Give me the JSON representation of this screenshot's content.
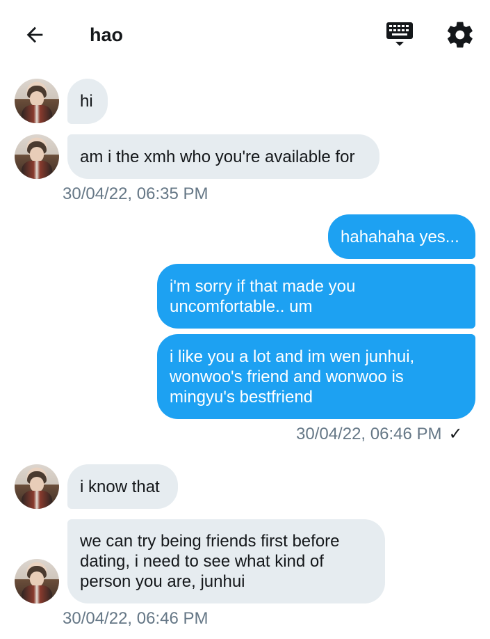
{
  "header": {
    "title": "hao",
    "back_icon": "arrow-left-icon",
    "keyboard_icon": "keyboard-icon",
    "settings_icon": "gear-icon"
  },
  "messages": [
    {
      "side": "in",
      "text": "hi"
    },
    {
      "side": "in",
      "text": "am i the xmh who you're available for"
    },
    {
      "timestamp": "30/04/22, 06:35 PM"
    },
    {
      "side": "out",
      "text": "hahahaha yes..."
    },
    {
      "side": "out",
      "text": "i'm sorry if that made you\nuncomfortable.. um"
    },
    {
      "side": "out",
      "text": "i like you a lot and im wen junhui,\nwonwoo's friend and wonwoo is\nmingyu's bestfriend"
    },
    {
      "timestamp": "30/04/22, 06:46 PM",
      "status": "✓"
    },
    {
      "side": "in",
      "text": "i know that"
    },
    {
      "side": "in",
      "text": "we can try being friends first before\ndating, i need to see what kind of\nperson you are,  junhui"
    },
    {
      "timestamp": "30/04/22, 06:46 PM"
    }
  ],
  "colors": {
    "outgoing_bubble": "#1da1f2",
    "incoming_bubble": "#e6ecf0",
    "timestamp_text": "#657786"
  }
}
